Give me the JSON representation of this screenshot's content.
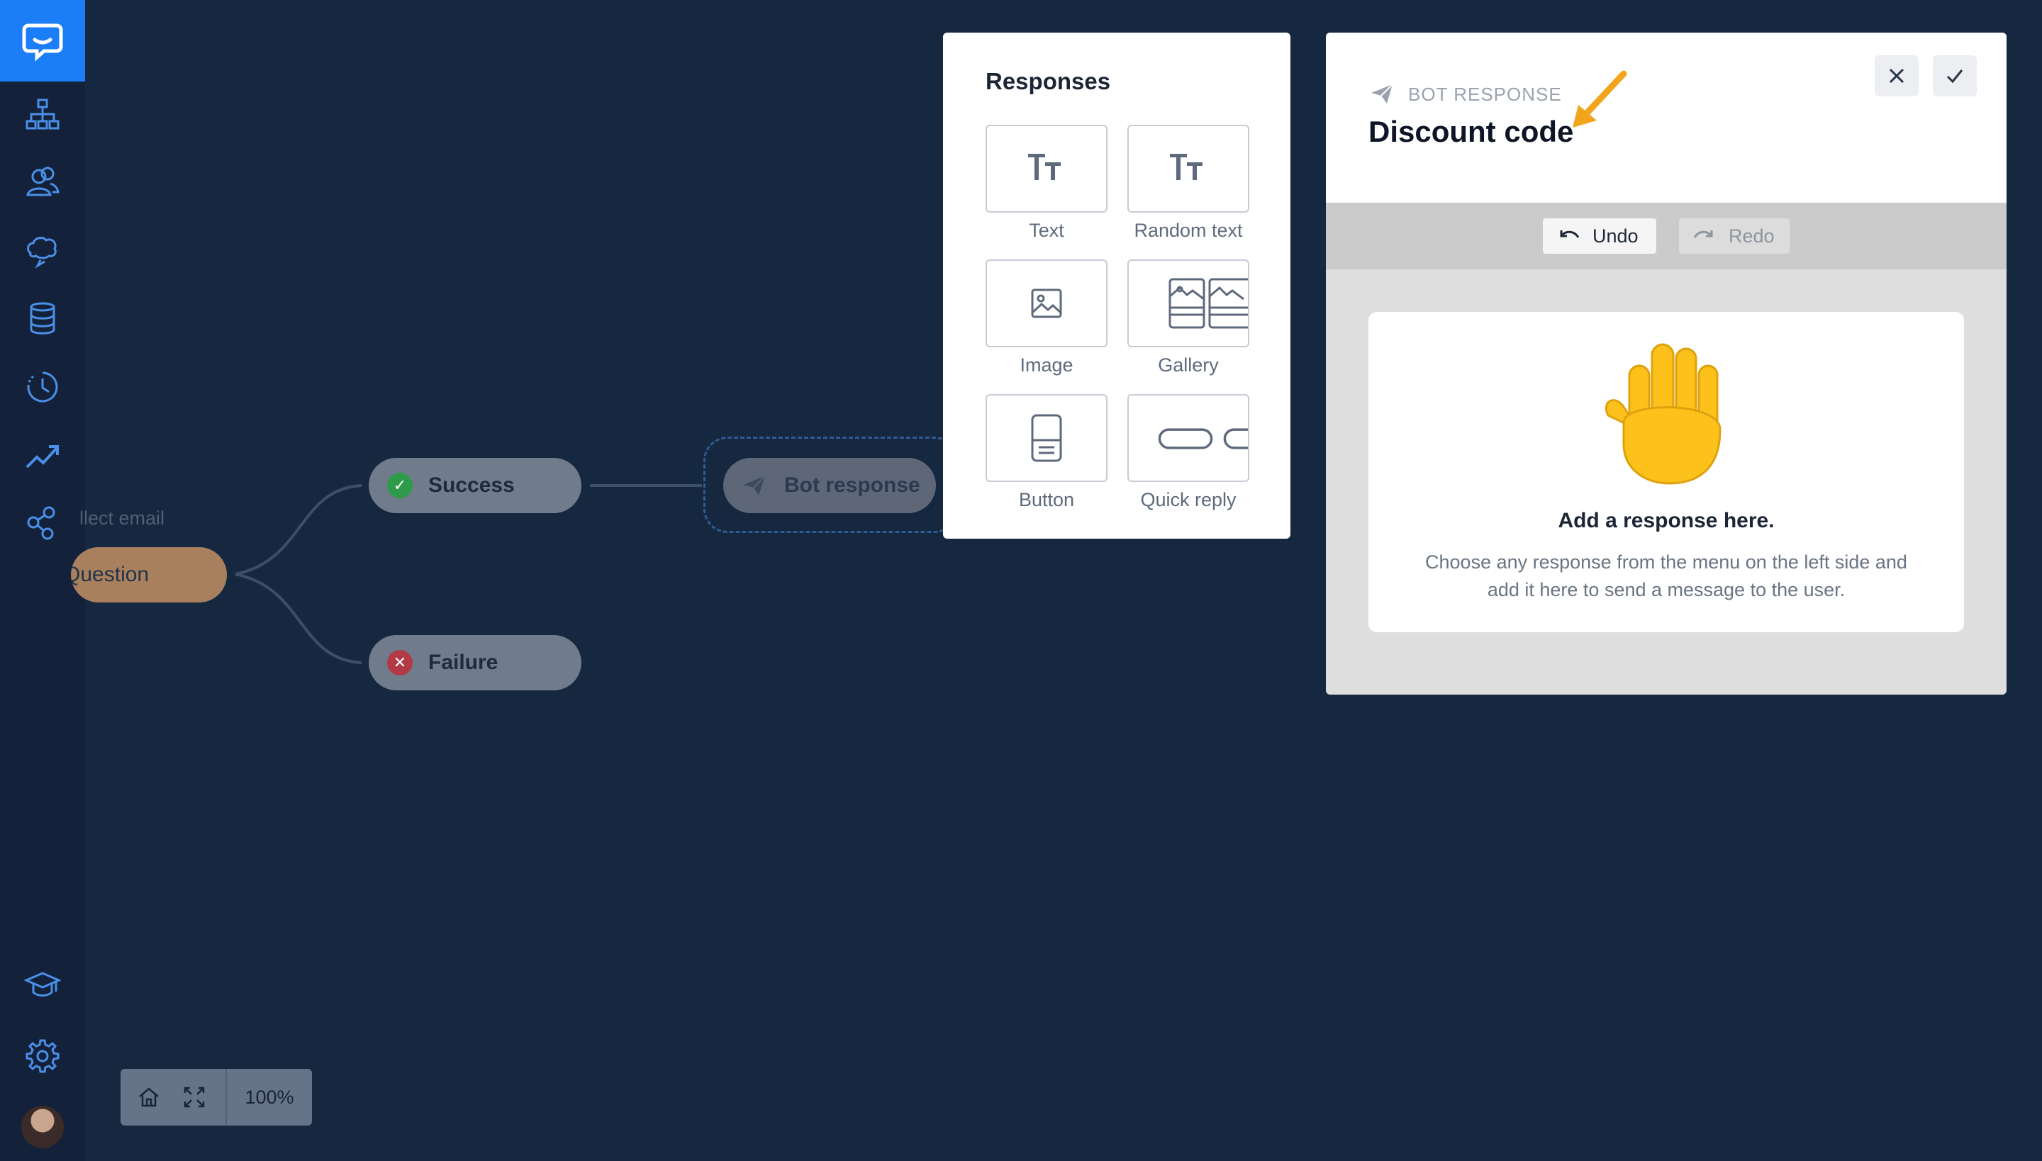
{
  "sidebar": {
    "items": [
      "chatbot-logo",
      "flow-icon",
      "users-icon",
      "chat-cloud-icon",
      "database-icon",
      "history-icon",
      "analytics-icon",
      "integrations-icon",
      "academy-icon",
      "settings-icon",
      "user-avatar"
    ]
  },
  "canvas": {
    "question_label": "llect email",
    "question_node": "Question",
    "success_node": "Success",
    "failure_node": "Failure",
    "bot_node": "Bot response"
  },
  "zoom": {
    "value": "100%"
  },
  "responses": {
    "title": "Responses",
    "items": [
      {
        "label": "Text",
        "icon": "text-icon"
      },
      {
        "label": "Random text",
        "icon": "random-text-icon"
      },
      {
        "label": "Image",
        "icon": "image-icon"
      },
      {
        "label": "Gallery",
        "icon": "gallery-icon"
      },
      {
        "label": "Button",
        "icon": "button-icon"
      },
      {
        "label": "Quick reply",
        "icon": "quick-reply-icon"
      }
    ]
  },
  "editor": {
    "subtitle": "BOT RESPONSE",
    "title": "Discount code",
    "undo": "Undo",
    "redo": "Redo",
    "drop_title": "Add a response here.",
    "drop_description": "Choose any response from the menu on the left side and add it here to send a message to the user."
  },
  "colors": {
    "canvas_bg": "#16283f",
    "sidebar_bg": "#13223a",
    "brand_blue": "#1c7ef6",
    "question_node": "#a8805e",
    "success_green": "#2e9b4a",
    "failure_red": "#b23a44",
    "arrow_orange": "#f2a41b"
  }
}
